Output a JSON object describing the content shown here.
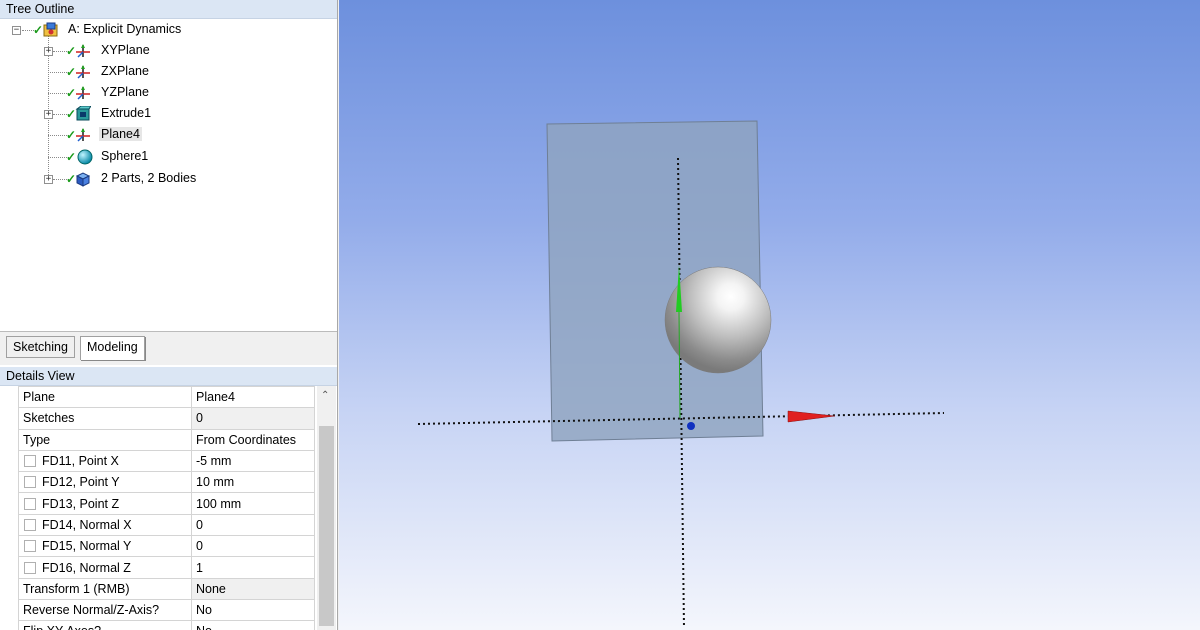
{
  "tree_outline": {
    "header": "Tree Outline",
    "items": [
      {
        "label": "A: Explicit Dynamics",
        "expander": "−"
      },
      {
        "label": "XYPlane",
        "expander": "+"
      },
      {
        "label": "ZXPlane"
      },
      {
        "label": "YZPlane"
      },
      {
        "label": "Extrude1",
        "expander": "+"
      },
      {
        "label": "Plane4",
        "selected": true
      },
      {
        "label": "Sphere1"
      },
      {
        "label": "2 Parts, 2 Bodies",
        "expander": "+"
      }
    ]
  },
  "tabs": {
    "sketching": "Sketching",
    "modeling": "Modeling"
  },
  "details_view": {
    "header": "Details View",
    "rows": [
      {
        "prop": "Plane",
        "value": "Plane4"
      },
      {
        "prop": "Sketches",
        "value": "0"
      },
      {
        "prop": "Type",
        "value": "From Coordinates"
      },
      {
        "prop": "FD11, Point X",
        "value": "-5 mm"
      },
      {
        "prop": "FD12, Point Y",
        "value": "10 mm"
      },
      {
        "prop": "FD13, Point Z",
        "value": "100 mm"
      },
      {
        "prop": "FD14, Normal X",
        "value": "0"
      },
      {
        "prop": "FD15, Normal Y",
        "value": "0"
      },
      {
        "prop": "FD16, Normal Z",
        "value": "1"
      },
      {
        "prop": "Transform 1 (RMB)",
        "value": "None"
      },
      {
        "prop": "Reverse Normal/Z-Axis?",
        "value": "No"
      },
      {
        "prop": "Flip XY-Axes?",
        "value": "No"
      }
    ]
  },
  "icons": {
    "check": "check-icon",
    "project": "explicit-dynamics-icon",
    "plane": "plane-axes-icon",
    "extrude": "extrude-icon",
    "sphere": "sphere-icon",
    "parts": "parts-bodies-icon"
  },
  "colors": {
    "panel_header_bg": "#dbe6f4",
    "check_green": "#1a9a1a",
    "viewport_top": "#6d90dd",
    "viewport_bottom": "#f4f6fc",
    "plane_fill": "#8fa4bf",
    "x_axis": "#e02020",
    "y_axis": "#20c020",
    "z_axis": "#1030c0"
  }
}
